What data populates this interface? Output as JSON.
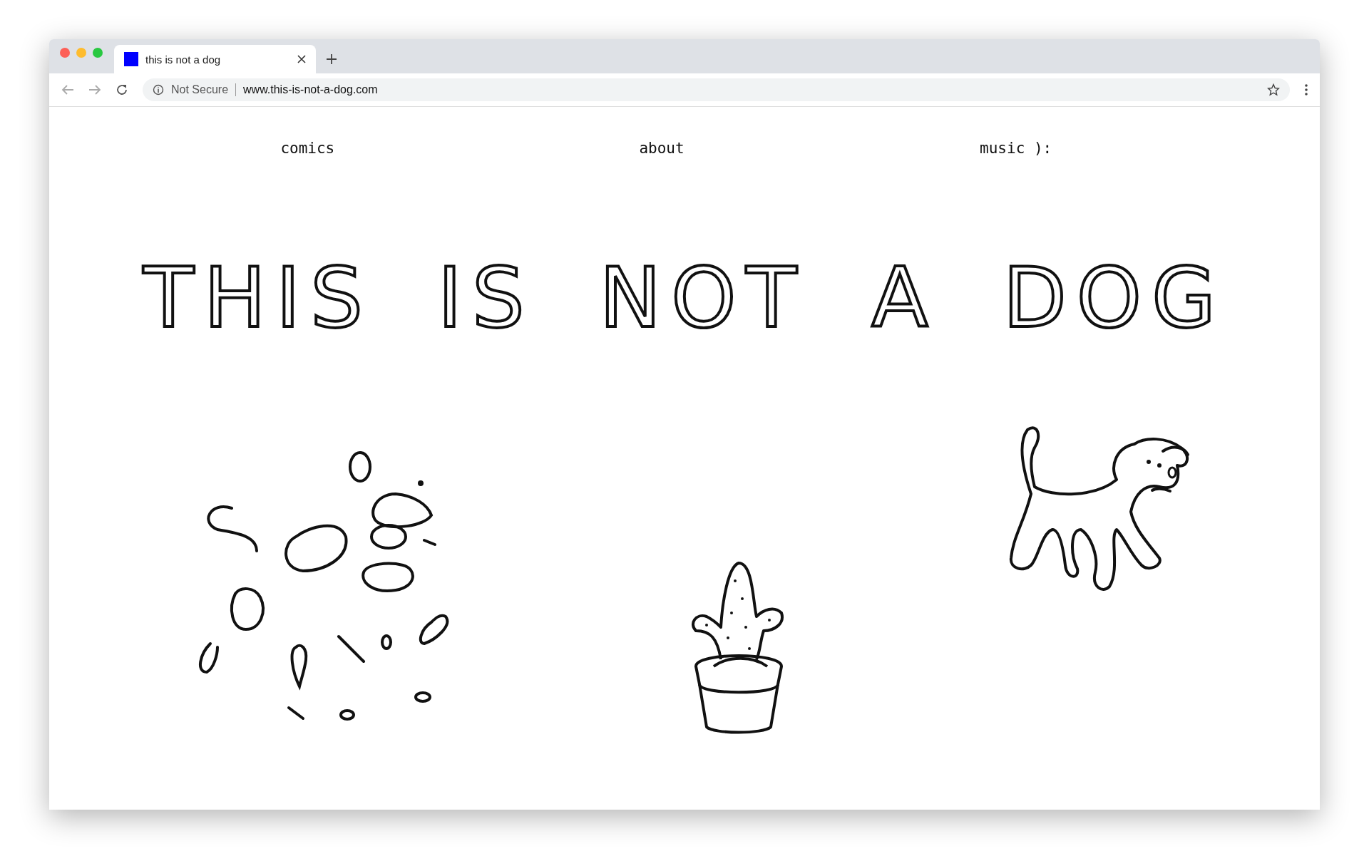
{
  "tab": {
    "title": "this is not a dog",
    "selected": true
  },
  "address_bar": {
    "security": "Not Secure",
    "url": "www.this-is-not-a-dog.com"
  },
  "nav": [
    "comics",
    "about",
    "music ):"
  ],
  "heading": "THIS IS NOT A DOG"
}
